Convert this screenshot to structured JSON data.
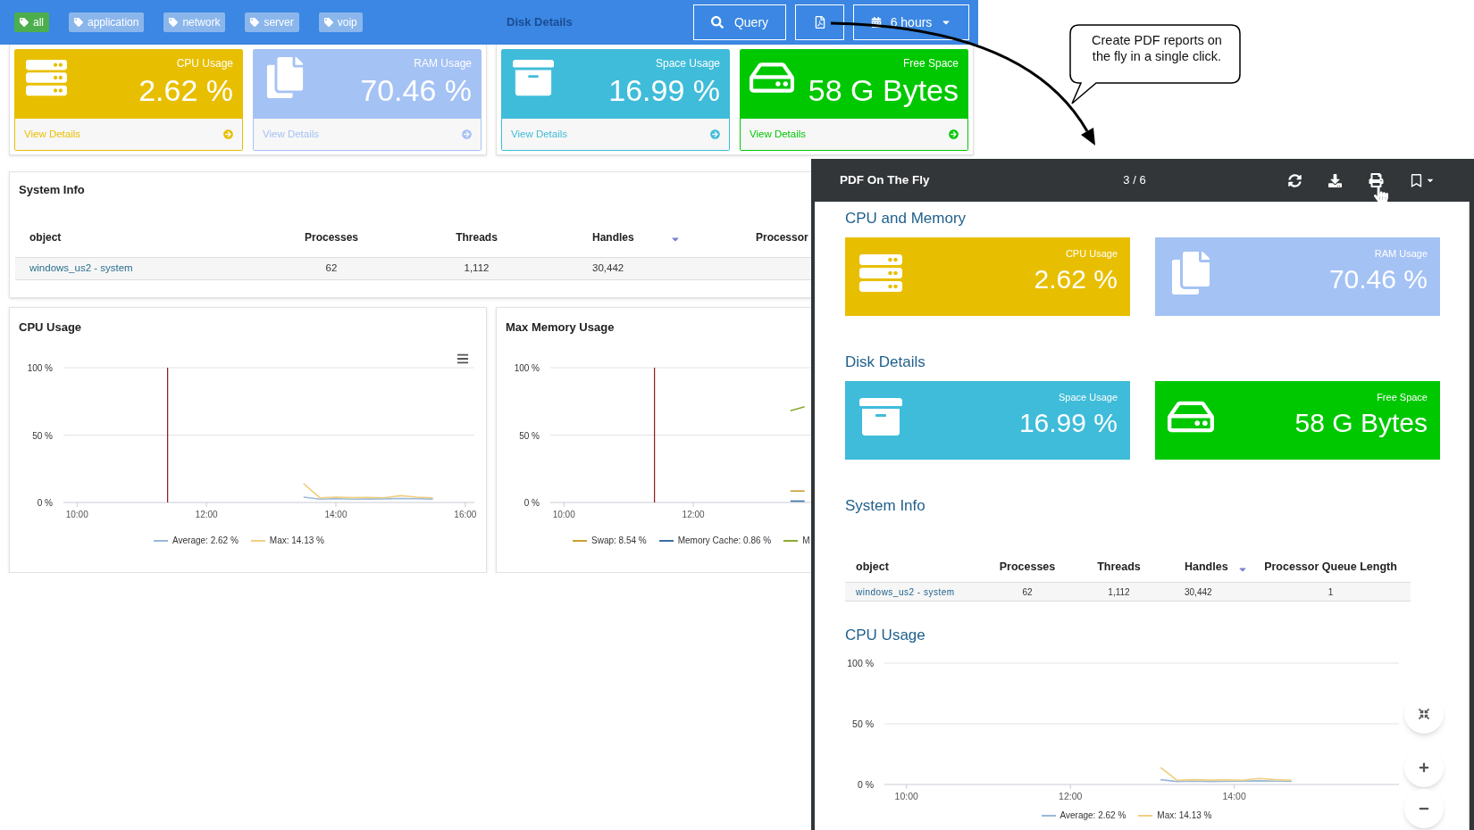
{
  "top_bar": {
    "tags": [
      {
        "label": "all",
        "selected": true
      },
      {
        "label": "application",
        "selected": false
      },
      {
        "label": "network",
        "selected": false
      },
      {
        "label": "server",
        "selected": false
      },
      {
        "label": "voip",
        "selected": false
      }
    ],
    "section_title": "Disk Details",
    "query_button": "Query",
    "range_button": "6 hours"
  },
  "stat_panels": [
    {
      "cards": [
        {
          "kind": "server",
          "label": "CPU Usage",
          "value": "2.62 %",
          "color": "#e8bf00",
          "link": "View Details"
        },
        {
          "kind": "files",
          "label": "RAM Usage",
          "value": "70.46 %",
          "color": "#a4c2f4",
          "link": "View Details"
        }
      ]
    },
    {
      "cards": [
        {
          "kind": "archive",
          "label": "Space Usage",
          "value": "16.99 %",
          "color": "#3fbcd9",
          "link": "View Details"
        },
        {
          "kind": "drive",
          "label": "Free Space",
          "value": "58 G Bytes",
          "color": "#00c800",
          "link": "View Details"
        }
      ]
    }
  ],
  "system_info": {
    "title": "System Info",
    "columns": [
      {
        "label": "object",
        "sorted": false
      },
      {
        "label": "Processes",
        "sorted": false
      },
      {
        "label": "Threads",
        "sorted": false
      },
      {
        "label": "Handles",
        "sorted": true
      },
      {
        "label": "Processor",
        "sorted": false
      }
    ],
    "rows": [
      [
        "windows_us2 - system",
        "62",
        "1,112",
        "30,442"
      ]
    ]
  },
  "charts": [
    {
      "menu": true,
      "chart_data": {
        "type": "line",
        "title": "CPU Usage",
        "x": [
          13.5,
          13.75,
          14,
          14.25,
          14.5,
          14.75,
          15,
          15.25,
          15.5
        ],
        "series": [
          {
            "name": "Average: 2.62 %",
            "color": "#9bb8d8",
            "values": [
              4,
              2.5,
              2.8,
              2.5,
              2.6,
              2.7,
              3,
              2.8,
              2.6
            ]
          },
          {
            "name": "Max: 14.13 %",
            "color": "#f0d080",
            "values": [
              14,
              3.5,
              4,
              3.6,
              3.8,
              3.5,
              5,
              4,
              3.5
            ]
          }
        ],
        "xlim": [
          9.79,
          16.14
        ],
        "ylim": [
          0,
          100
        ],
        "xticks": [
          {
            "value": 10,
            "label": "10:00"
          },
          {
            "value": 12,
            "label": "12:00"
          },
          {
            "value": 14,
            "label": "14:00"
          },
          {
            "value": 16,
            "label": "16:00"
          }
        ],
        "yticks": [
          {
            "value": 0,
            "label": "0 %"
          },
          {
            "value": 50,
            "label": "50 %"
          },
          {
            "value": 100,
            "label": "100 %"
          }
        ],
        "ref_lines": [
          {
            "axis": "x",
            "value": 11.4
          }
        ]
      }
    },
    {
      "chart_data": {
        "type": "line",
        "title": "Max Memory Usage",
        "x": [
          13.5,
          13.72
        ],
        "series": [
          {
            "name": "Swap: 8.54 %",
            "color": "#c8a030",
            "values": [
              8.5,
              8.5
            ]
          },
          {
            "name": "Memory Cache: 0.86 %",
            "color": "#3a6ea5",
            "values": [
              1,
              1
            ]
          },
          {
            "name": "M",
            "color": "#8aaa30",
            "values": [
              68,
              71
            ]
          }
        ],
        "xlim": [
          9.79,
          16.14
        ],
        "ylim": [
          0,
          100
        ],
        "xticks": [
          {
            "value": 10,
            "label": "10:00"
          },
          {
            "value": 12,
            "label": "12:00"
          }
        ],
        "yticks": [
          {
            "value": 0,
            "label": "0 %"
          },
          {
            "value": 50,
            "label": "50 %"
          },
          {
            "value": 100,
            "label": "100 %"
          }
        ],
        "ref_lines": [
          {
            "axis": "x",
            "value": 11.4
          }
        ]
      }
    }
  ],
  "callout": "Create PDF reports on the fly in a single click.",
  "pdf_viewer": {
    "title": "PDF On The Fly",
    "page": "3 / 6",
    "sections": [
      {
        "kind": "cards",
        "title": "CPU and Memory",
        "cards": [
          {
            "kind": "server",
            "label": "CPU Usage",
            "value": "2.62 %",
            "color": "#e8bf00"
          },
          {
            "kind": "files",
            "label": "RAM Usage",
            "value": "70.46 %",
            "color": "#a4c2f4"
          }
        ]
      },
      {
        "kind": "cards",
        "title": "Disk Details",
        "cards": [
          {
            "kind": "archive",
            "label": "Space Usage",
            "value": "16.99 %",
            "color": "#3fbcd9"
          },
          {
            "kind": "drive",
            "label": "Free Space",
            "value": "58 G Bytes",
            "color": "#00c800"
          }
        ]
      },
      {
        "kind": "table",
        "title": "System Info",
        "columns": [
          {
            "label": "object",
            "sorted": false
          },
          {
            "label": "Processes",
            "sorted": false
          },
          {
            "label": "Threads",
            "sorted": false
          },
          {
            "label": "Handles",
            "sorted": true
          },
          {
            "label": "Processor Queue Length",
            "sorted": false
          }
        ],
        "rows": [
          [
            "windows_us2 - system",
            "62",
            "1,112",
            "30,442",
            "1"
          ]
        ]
      },
      {
        "kind": "chart",
        "chart_data": {
          "type": "line",
          "title": "CPU Usage",
          "x": [
            13.1,
            13.3,
            13.5,
            13.7,
            13.9,
            14.1,
            14.3,
            14.5,
            14.7
          ],
          "series": [
            {
              "name": "Average: 2.62 %",
              "color": "#9bb8d8",
              "values": [
                4,
                2.5,
                2.8,
                2.5,
                2.6,
                2.7,
                3,
                2.8,
                2.6
              ]
            },
            {
              "name": "Max: 14.13 %",
              "color": "#f0d080",
              "values": [
                14,
                3.5,
                4,
                3.6,
                3.8,
                3.5,
                5,
                4,
                3.5
              ]
            }
          ],
          "xlim": [
            9.73,
            16.01
          ],
          "ylim": [
            0,
            100
          ],
          "xticks": [
            {
              "value": 10,
              "label": "10:00"
            },
            {
              "value": 12,
              "label": "12:00"
            },
            {
              "value": 14,
              "label": "14:00"
            }
          ],
          "yticks": [
            {
              "value": 0,
              "label": "0 %"
            },
            {
              "value": 50,
              "label": "50 %"
            },
            {
              "value": 100,
              "label": "100 %"
            }
          ]
        }
      }
    ]
  }
}
